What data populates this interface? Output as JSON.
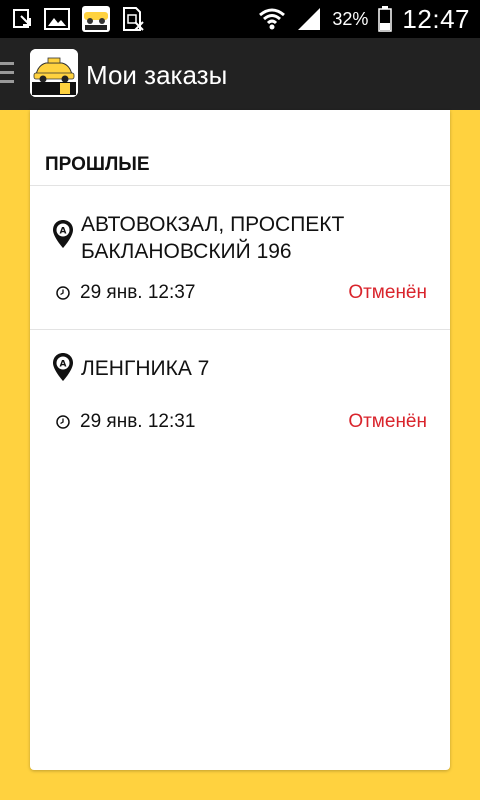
{
  "status_bar": {
    "icons": [
      "download-icon",
      "gallery-icon",
      "app-notification-icon",
      "sim-icon",
      "wifi-icon",
      "signal-icon",
      "battery-icon"
    ],
    "battery_percent": "32%",
    "time": "12:47"
  },
  "action_bar": {
    "title": "Мои заказы"
  },
  "section": {
    "title": "ПРОШЛЫЕ"
  },
  "orders": [
    {
      "address": "АВТОВОКЗАЛ, ПРОСПЕКТ БАКЛАНОВСКИЙ 196",
      "time": "29 янв. 12:37",
      "status": "Отменён"
    },
    {
      "address": "ЛЕНГНИКА 7",
      "time": "29 янв. 12:31",
      "status": "Отменён"
    }
  ],
  "colors": {
    "accent": "#FFD23F",
    "status_cancelled": "#D9242C",
    "action_bar_bg": "#222222"
  }
}
